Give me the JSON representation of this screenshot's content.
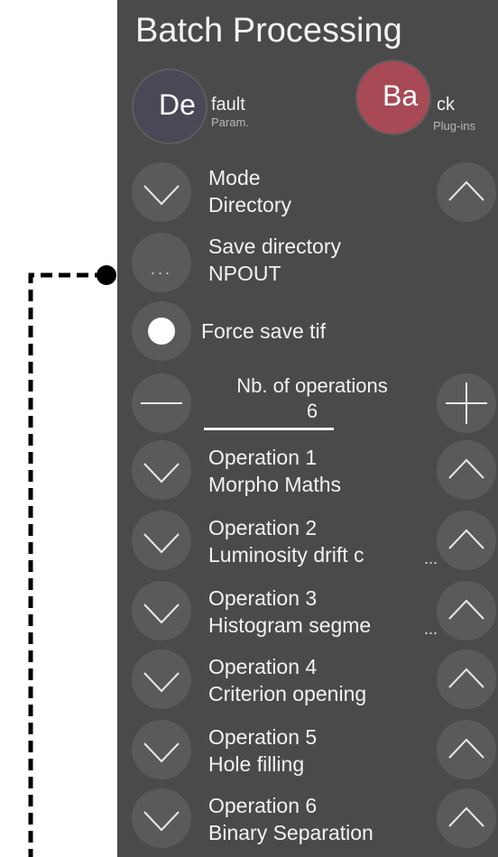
{
  "panel": {
    "title": "Batch Processing",
    "default_button": {
      "big": "De",
      "small": "fault",
      "sub": "Param.",
      "color": "#4a4757"
    },
    "back_button": {
      "big": "Ba",
      "small": "ck",
      "sub": "Plug-ins",
      "color": "#a84a56"
    },
    "mode": {
      "label": "Mode",
      "value": "Directory"
    },
    "save_directory": {
      "label": "Save directory",
      "value": "NPOUT",
      "button_glyph": "..."
    },
    "force_save": {
      "label": "Force save tif",
      "checked": true
    },
    "operations_count": {
      "label": "Nb. of operations",
      "value": "6"
    },
    "operations": [
      {
        "label": "Operation 1",
        "value": "Morpho Maths",
        "truncated": false
      },
      {
        "label": "Operation 2",
        "value": "Luminosity drift c",
        "truncated": true
      },
      {
        "label": "Operation 3",
        "value": "Histogram segme",
        "truncated": true
      },
      {
        "label": "Operation 4",
        "value": "Criterion opening",
        "truncated": false
      },
      {
        "label": "Operation 5",
        "value": "Hole filling",
        "truncated": false
      },
      {
        "label": "Operation 6",
        "value": "Binary Separation",
        "truncated": false
      }
    ],
    "ellipsis": "..."
  },
  "icons": {
    "down": "chevron-down-icon",
    "up": "chevron-up-icon",
    "minus": "minus-icon",
    "plus": "plus-icon",
    "more": "more-icon",
    "radio": "radio-icon"
  }
}
